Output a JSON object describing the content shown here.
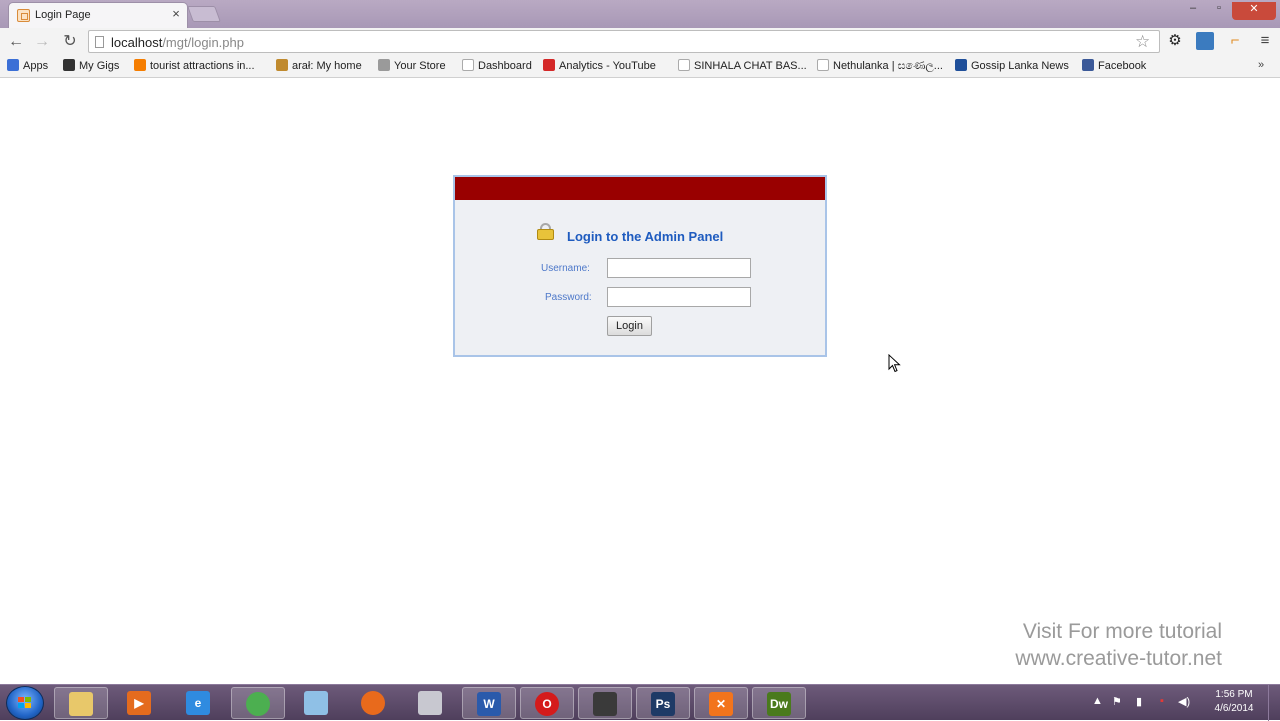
{
  "browser": {
    "tab": {
      "title": "Login Page",
      "close": "×"
    },
    "window_controls": {
      "minimize": "–",
      "maximize": "▫",
      "close": "✕"
    },
    "nav": {
      "back": "←",
      "forward": "→",
      "reload": "↻"
    },
    "url": {
      "host": "localhost",
      "path": "/mgt/login.php"
    },
    "bookmarks": [
      {
        "label": "Apps",
        "icon": "apps-grid-icon",
        "color": "#3b6fd6"
      },
      {
        "label": "My Gigs",
        "icon": "gigs-icon",
        "color": "#333333"
      },
      {
        "label": "tourist attractions in...",
        "icon": "blogger-icon",
        "color": "#f57d00"
      },
      {
        "label": "arał: My home",
        "icon": "home-icon",
        "color": "#c08a2e"
      },
      {
        "label": "Your Store",
        "icon": "store-icon",
        "color": "#9a9a9a"
      },
      {
        "label": "Dashboard",
        "icon": "page-icon",
        "color": "#ffffff"
      },
      {
        "label": "Analytics - YouTube",
        "icon": "youtube-icon",
        "color": "#d42828"
      },
      {
        "label": "SINHALA CHAT BAS...",
        "icon": "page-icon",
        "color": "#ffffff"
      },
      {
        "label": "Nethulanka | ඝණෙල...",
        "icon": "page-icon",
        "color": "#ffffff"
      },
      {
        "label": "Gossip Lanka News",
        "icon": "gossip-icon",
        "color": "#1f4f9a"
      },
      {
        "label": "Facebook",
        "icon": "facebook-icon",
        "color": "#3b5998"
      }
    ],
    "bookmarks_more": "»"
  },
  "login": {
    "title": "Login to the Admin Panel",
    "username_label": "Username:",
    "password_label": "Password:",
    "username_value": "",
    "password_value": "",
    "button_label": "Login",
    "header_color": "#990000",
    "title_color": "#1e5bbf"
  },
  "watermark": {
    "line1": "Visit  For  more tutorial",
    "line2": "www.creative-tutor.net"
  },
  "taskbar": {
    "apps": [
      {
        "name": "explorer",
        "icon": "folder-icon",
        "color": "#e8c86a",
        "glyph": ""
      },
      {
        "name": "media-player",
        "icon": "media-player-icon",
        "color": "#e46b1e",
        "glyph": "▶"
      },
      {
        "name": "internet-explorer",
        "icon": "ie-icon",
        "color": "#2f8be0",
        "glyph": "e"
      },
      {
        "name": "chrome",
        "icon": "chrome-icon",
        "color": "#4caf50",
        "glyph": ""
      },
      {
        "name": "notepad",
        "icon": "notepad-icon",
        "color": "#8fc0e6",
        "glyph": ""
      },
      {
        "name": "firefox",
        "icon": "firefox-icon",
        "color": "#e86a1c",
        "glyph": ""
      },
      {
        "name": "paint",
        "icon": "paint-icon",
        "color": "#c8c8d0",
        "glyph": ""
      },
      {
        "name": "word",
        "icon": "word-icon",
        "color": "#2a5aab",
        "glyph": "W"
      },
      {
        "name": "opera",
        "icon": "opera-icon",
        "color": "#d41b1b",
        "glyph": "O"
      },
      {
        "name": "camtasia",
        "icon": "camera-icon",
        "color": "#3a3a3a",
        "glyph": ""
      },
      {
        "name": "photoshop",
        "icon": "photoshop-icon",
        "color": "#1e3a66",
        "glyph": "Ps"
      },
      {
        "name": "xampp",
        "icon": "xampp-icon",
        "color": "#f2741c",
        "glyph": "✕"
      },
      {
        "name": "dreamweaver",
        "icon": "dreamweaver-icon",
        "color": "#4a7a1c",
        "glyph": "Dw"
      }
    ],
    "tray": {
      "expand": "▲",
      "flag": "⚑",
      "battery": "▮",
      "volume": "◀)"
    },
    "clock": {
      "time": "1:56 PM",
      "date": "4/6/2014"
    }
  }
}
